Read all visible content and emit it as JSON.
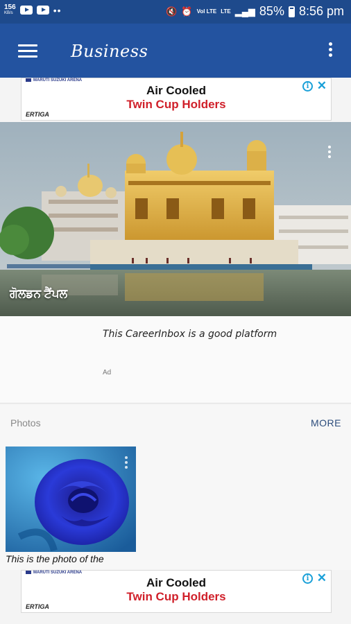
{
  "status_bar": {
    "speed_value": "156",
    "speed_unit": "KB/s",
    "volte": "Vol LTE",
    "lte": "LTE",
    "battery_percent": "85%",
    "time": "8:56 pm"
  },
  "app_bar": {
    "title": "Business"
  },
  "ad_top": {
    "brand": "MARUTI SUZUKI ARENA",
    "line1": "Air Cooled",
    "line2": "Twin Cup Holders",
    "model": "ERTIGA"
  },
  "hero": {
    "caption": "ਗੋਲਡਨ ਟੈਂਪਲ"
  },
  "post": {
    "text": "This CareerInbox is a good platform",
    "ad_label": "Ad"
  },
  "photos": {
    "title": "Photos",
    "more_label": "MORE",
    "items": [
      {
        "caption": "This is the photo of the"
      }
    ]
  },
  "ad_bottom": {
    "brand": "MARUTI SUZUKI ARENA",
    "line1": "Air Cooled",
    "line2": "Twin Cup Holders",
    "model": "ERTIGA"
  }
}
